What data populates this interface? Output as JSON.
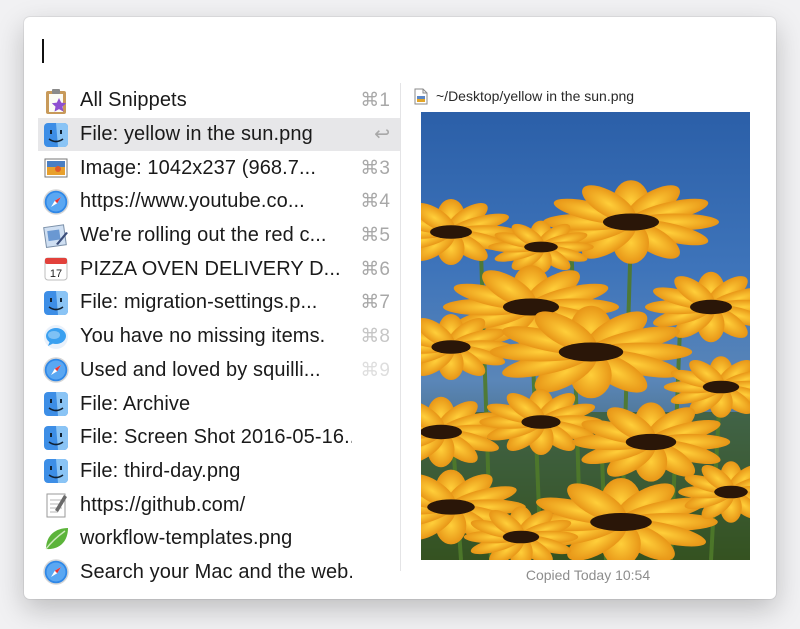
{
  "search": {
    "value": "",
    "placeholder": ""
  },
  "items": [
    {
      "icon": "snippets-clipboard-icon",
      "label": "All Snippets",
      "shortcut": "⌘1"
    },
    {
      "icon": "finder-icon",
      "label": "File: yellow in the sun.png",
      "shortcut": "↩",
      "selected": true
    },
    {
      "icon": "preview-image-icon",
      "label": "Image: 1042x237 (968.7...",
      "shortcut": "⌘3"
    },
    {
      "icon": "safari-icon",
      "label": "https://www.youtube.co...",
      "shortcut": "⌘4"
    },
    {
      "icon": "mail-icon",
      "label": "We're rolling out the red c...",
      "shortcut": "⌘5"
    },
    {
      "icon": "calendar-icon",
      "label": "PIZZA OVEN DELIVERY D...",
      "shortcut": "⌘6",
      "calendar_day": "17"
    },
    {
      "icon": "finder-icon",
      "label": "File: migration-settings.p...",
      "shortcut": "⌘7"
    },
    {
      "icon": "messages-icon",
      "label": "You have no missing items.",
      "shortcut": "⌘8"
    },
    {
      "icon": "safari-icon",
      "label": "Used and loved by squilli...",
      "shortcut": "⌘9"
    },
    {
      "icon": "finder-icon",
      "label": "File: Archive",
      "shortcut": ""
    },
    {
      "icon": "finder-icon",
      "label": "File: Screen Shot 2016-05-16...",
      "shortcut": ""
    },
    {
      "icon": "finder-icon",
      "label": "File: third-day.png",
      "shortcut": ""
    },
    {
      "icon": "textedit-icon",
      "label": "https://github.com/",
      "shortcut": ""
    },
    {
      "icon": "leaf-icon",
      "label": "workflow-templates.png",
      "shortcut": ""
    },
    {
      "icon": "safari-icon",
      "label": "Search your Mac and the web...",
      "shortcut": ""
    }
  ],
  "preview": {
    "path": "~/Desktop/yellow in the sun.png",
    "caption": "Copied Today 10:54",
    "image_subject": "yellow-flowers-photo"
  },
  "colors": {
    "selection": "#e7e7e9",
    "shortcut": "#a8a8a8",
    "sky": "#3b6fb4",
    "petal": "#f2a91c"
  }
}
